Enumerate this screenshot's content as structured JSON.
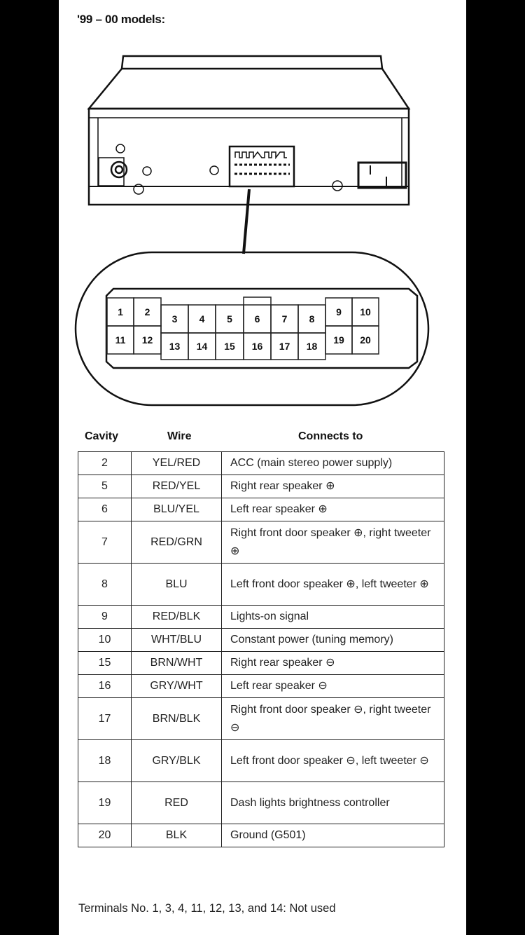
{
  "title": "'99 – 00 models:",
  "connector": {
    "top_row": [
      "1",
      "2",
      "3",
      "4",
      "5",
      "6",
      "7",
      "8",
      "9",
      "10"
    ],
    "bottom_row": [
      "11",
      "12",
      "13",
      "14",
      "15",
      "16",
      "17",
      "18",
      "19",
      "20"
    ]
  },
  "table": {
    "headers": {
      "cavity": "Cavity",
      "wire": "Wire",
      "connects_to": "Connects to"
    },
    "rows": [
      {
        "cavity": "2",
        "wire": "YEL/RED",
        "connects_to": "ACC (main stereo power supply)"
      },
      {
        "cavity": "5",
        "wire": "RED/YEL",
        "connects_to": "Right rear speaker ⊕"
      },
      {
        "cavity": "6",
        "wire": "BLU/YEL",
        "connects_to": "Left rear speaker ⊕"
      },
      {
        "cavity": "7",
        "wire": "RED/GRN",
        "connects_to": "Right front door speaker ⊕, right tweeter ⊕"
      },
      {
        "cavity": "8",
        "wire": "BLU",
        "connects_to": "Left front door speaker ⊕, left tweeter ⊕"
      },
      {
        "cavity": "9",
        "wire": "RED/BLK",
        "connects_to": "Lights-on signal"
      },
      {
        "cavity": "10",
        "wire": "WHT/BLU",
        "connects_to": "Constant power (tuning memory)"
      },
      {
        "cavity": "15",
        "wire": "BRN/WHT",
        "connects_to": "Right rear speaker ⊖"
      },
      {
        "cavity": "16",
        "wire": "GRY/WHT",
        "connects_to": "Left rear speaker ⊖"
      },
      {
        "cavity": "17",
        "wire": "BRN/BLK",
        "connects_to": "Right front door speaker ⊖, right tweeter ⊖"
      },
      {
        "cavity": "18",
        "wire": "GRY/BLK",
        "connects_to": "Left front door speaker ⊖, left tweeter ⊖"
      },
      {
        "cavity": "19",
        "wire": "RED",
        "connects_to": "Dash lights brightness controller"
      },
      {
        "cavity": "20",
        "wire": "BLK",
        "connects_to": "Ground (G501)"
      }
    ]
  },
  "footnote": "Terminals No. 1, 3, 4, 11, 12, 13, and 14: Not used"
}
